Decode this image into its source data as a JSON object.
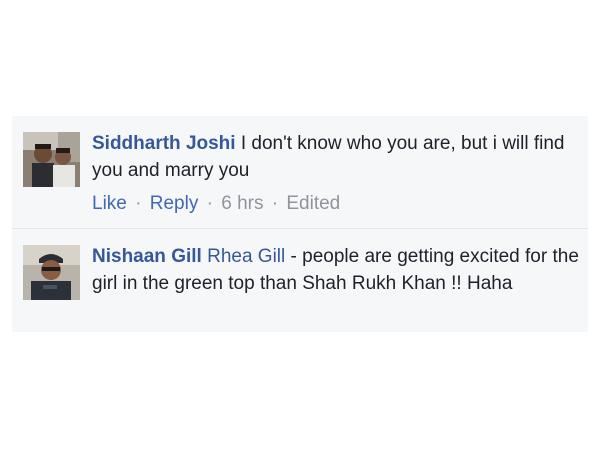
{
  "comments": [
    {
      "author": "Siddharth Joshi",
      "text": "I don't know who you are, but i will find you and marry you",
      "actions": {
        "like": "Like",
        "reply": "Reply",
        "time": "6 hrs",
        "edited": "Edited",
        "separator": "·"
      }
    },
    {
      "author": "Nishaan Gill",
      "mention": "Rhea Gill",
      "text": "- people are getting excited for the girl in the green top than Shah Rukh Khan !! Haha"
    }
  ],
  "colors": {
    "panel_bg": "#f6f7f9",
    "author_link": "#365899",
    "action_link": "#4267b2",
    "meta_text": "#90949c",
    "body_text": "#1d2129"
  }
}
